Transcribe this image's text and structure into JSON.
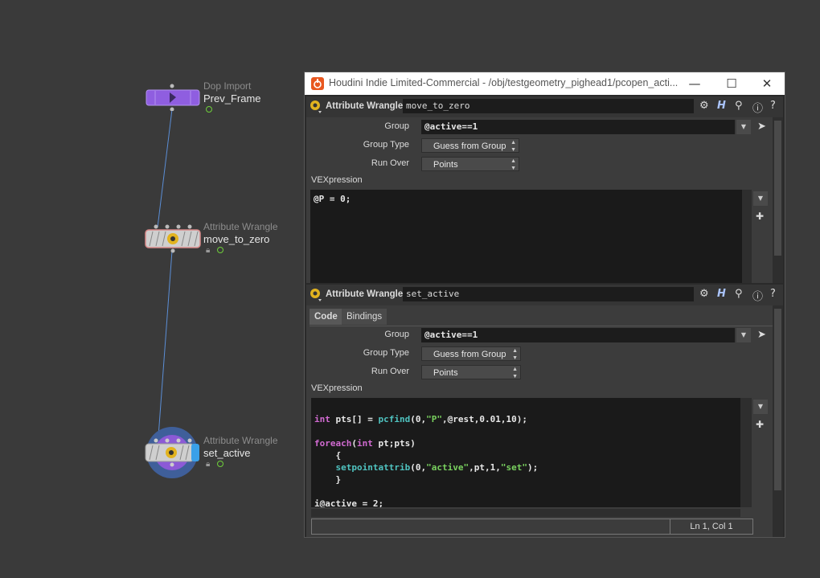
{
  "network": {
    "nodes": [
      {
        "type": "Dop Import",
        "name": "Prev_Frame"
      },
      {
        "type": "Attribute Wrangle",
        "name": "move_to_zero"
      },
      {
        "type": "Attribute Wrangle",
        "name": "set_active"
      }
    ]
  },
  "window": {
    "title": "Houdini Indie Limited-Commercial - /obj/testgeometry_pighead1/pcopen_acti...",
    "minimize": "—",
    "maximize": "☐",
    "close": "✕"
  },
  "panel1": {
    "op_label": "Attribute Wrangle",
    "node_name": "move_to_zero",
    "group_label": "Group",
    "group_value": "@active==1",
    "group_type_label": "Group Type",
    "group_type_value": "Guess from Group",
    "run_over_label": "Run Over",
    "run_over_value": "Points",
    "vex_label": "VEXpression",
    "code": "@P = 0;"
  },
  "panel2": {
    "op_label": "Attribute Wrangle",
    "node_name": "set_active",
    "tabs": [
      "Code",
      "Bindings"
    ],
    "group_label": "Group",
    "group_value": "@active==1",
    "group_type_label": "Group Type",
    "group_type_value": "Guess from Group",
    "run_over_label": "Run Over",
    "run_over_value": "Points",
    "vex_label": "VEXpression",
    "code_lines": [
      "int pts[] = pcfind(0,\"P\",@rest,0.01,10);",
      "",
      "foreach(int pt;pts)",
      "    {",
      "    setpointattrib(0,\"active\",pt,1,\"set\");",
      "    }",
      "",
      "i@active = 2;"
    ],
    "status": "Ln 1, Col 1"
  },
  "colors": {
    "network_bg": "#3a3a3a",
    "dop_node": "#8f5ee0",
    "wire": "#5b8ed6",
    "display_flag": "#3aa0e8"
  }
}
